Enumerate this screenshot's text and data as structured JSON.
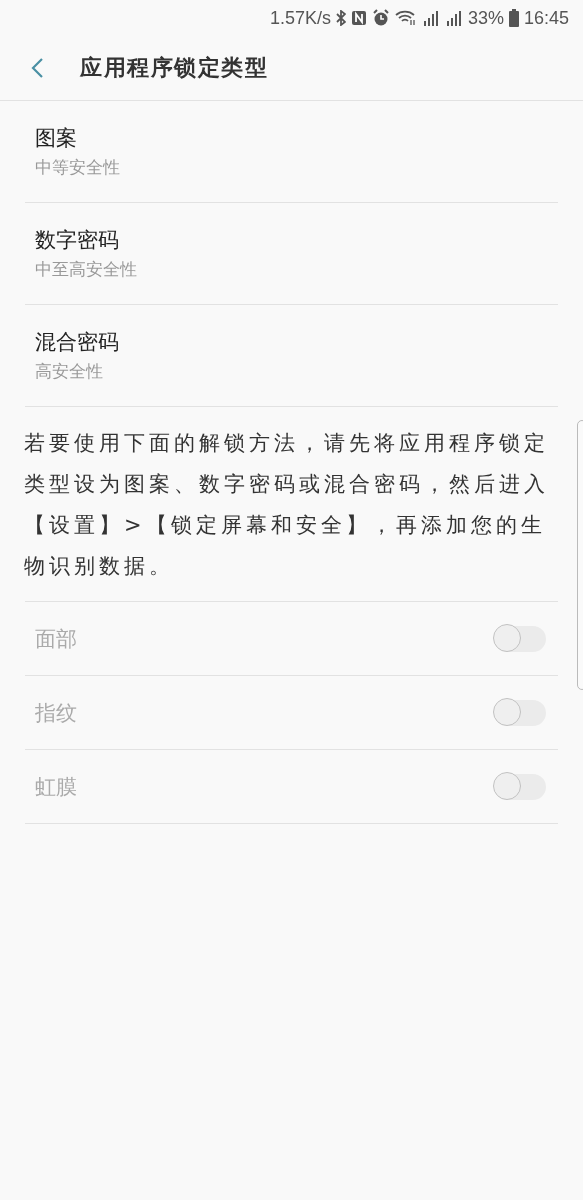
{
  "status_bar": {
    "speed": "1.57K/s",
    "battery": "33%",
    "time": "16:45"
  },
  "header": {
    "title": "应用程序锁定类型"
  },
  "lock_types": [
    {
      "title": "图案",
      "subtitle": "中等安全性"
    },
    {
      "title": "数字密码",
      "subtitle": "中至高安全性"
    },
    {
      "title": "混合密码",
      "subtitle": "高安全性"
    }
  ],
  "note": "若要使用下面的解锁方法，请先将应用程序锁定类型设为图案、数字密码或混合密码，然后进入【设置】>【锁定屏幕和安全】，再添加您的生物识别数据。",
  "biometrics": [
    {
      "label": "面部",
      "on": false,
      "disabled": true
    },
    {
      "label": "指纹",
      "on": false,
      "disabled": true
    },
    {
      "label": "虹膜",
      "on": false,
      "disabled": true
    }
  ]
}
